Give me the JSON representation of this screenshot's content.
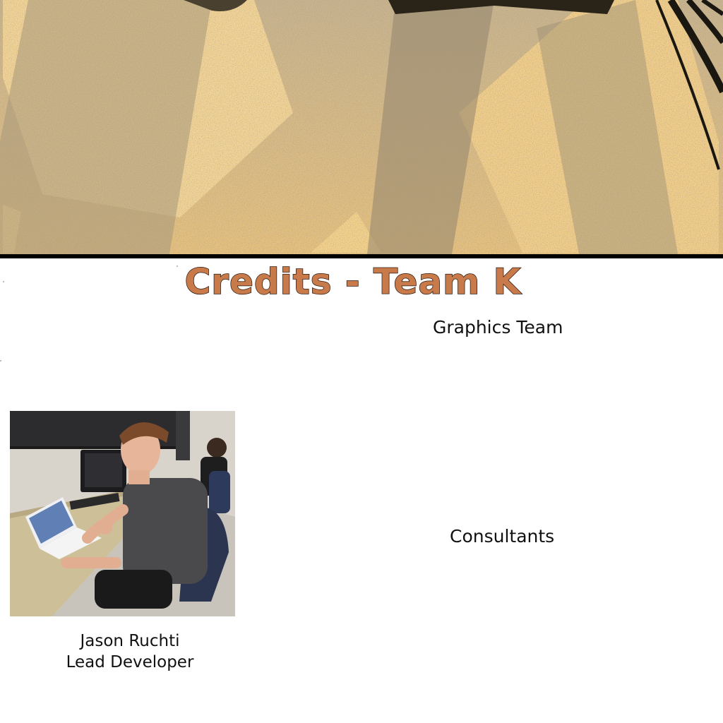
{
  "title": "Credits - Team K",
  "sections": {
    "graphics": "Graphics Team",
    "consultants": "Consultants"
  },
  "team": [
    {
      "name": "Jason Ruchti",
      "role": "Lead Developer"
    }
  ],
  "colors": {
    "title_fill": "#c87a4a",
    "title_outline": "#2a1a10",
    "banner_light": "#f8d28a",
    "banner_dark": "#8a7a62"
  }
}
